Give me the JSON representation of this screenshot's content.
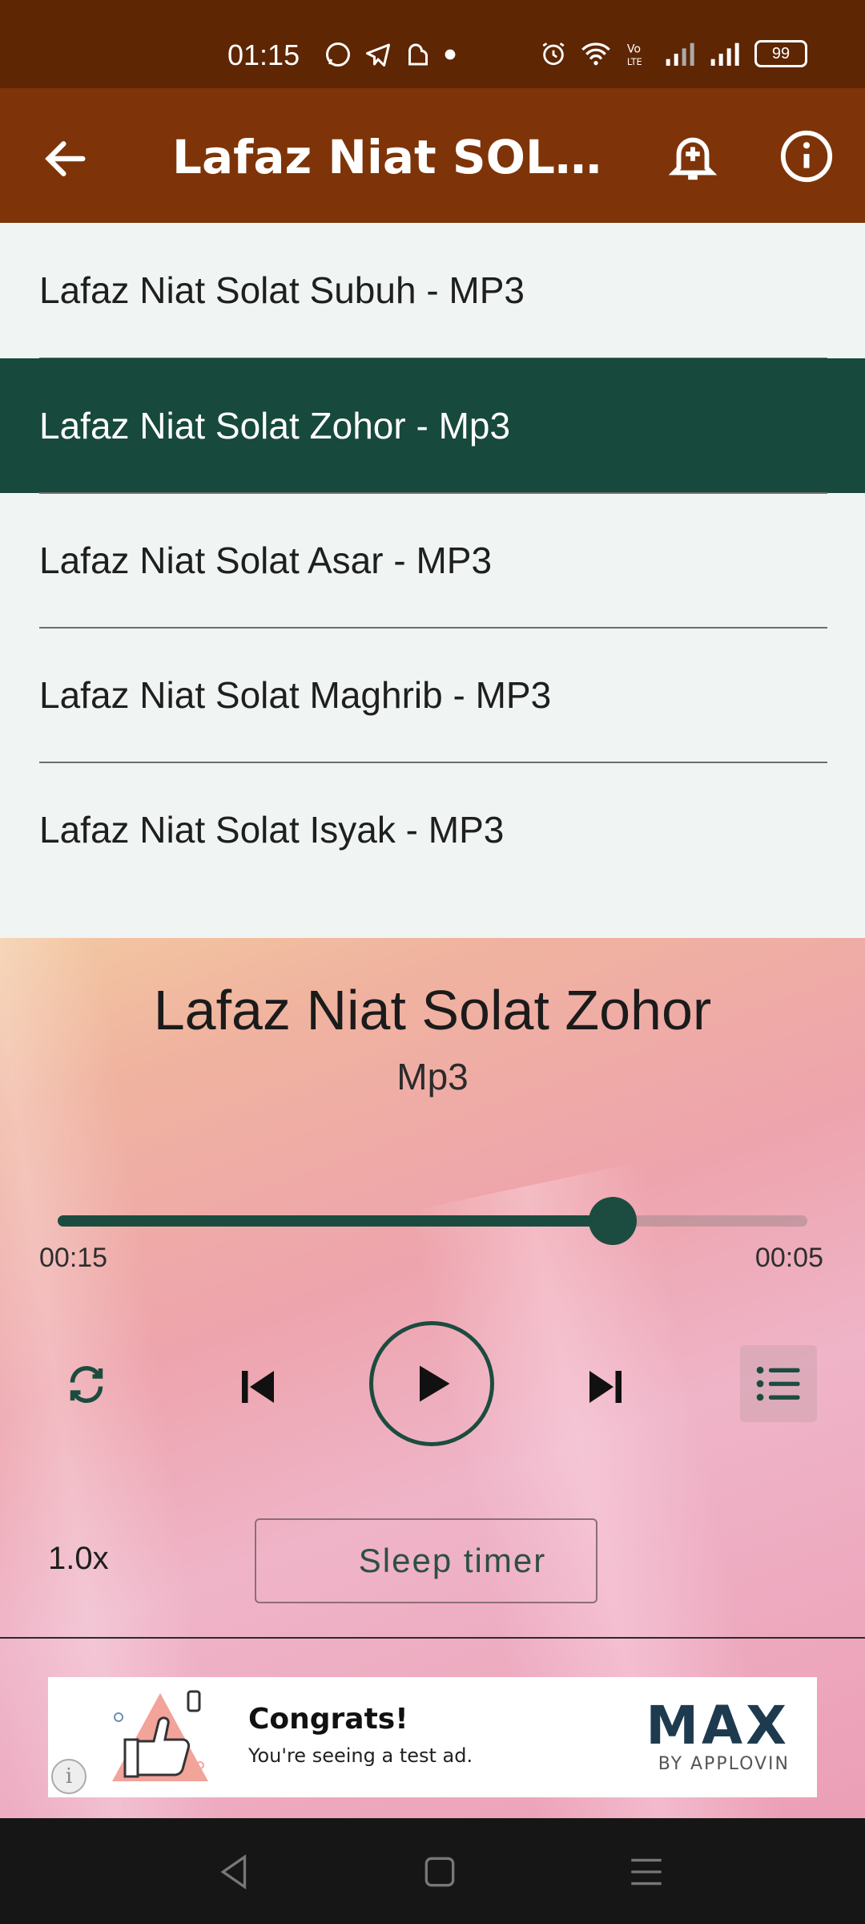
{
  "status_bar": {
    "time": "01:15",
    "battery": "99"
  },
  "app_bar": {
    "title": "Lafaz Niat SOLAT ..."
  },
  "tracks": [
    {
      "label": "Lafaz Niat Solat Subuh - MP3"
    },
    {
      "label": "Lafaz Niat Solat Zohor - Mp3"
    },
    {
      "label": "Lafaz Niat Solat Asar - MP3"
    },
    {
      "label": "Lafaz Niat Solat Maghrib - MP3"
    },
    {
      "label": "Lafaz Niat Solat Isyak - MP3"
    }
  ],
  "active_track_index": 1,
  "player": {
    "title": "Lafaz Niat Solat Zohor",
    "subtitle": "Mp3",
    "progress_fraction": 0.74,
    "time_elapsed": "00:15",
    "time_remaining": "00:05",
    "speed": "1.0x",
    "sleep_timer_label": "Sleep timer"
  },
  "ad": {
    "title": "Congrats!",
    "subtitle": "You're seeing a test ad.",
    "brand": "MAX",
    "brand_sub": "BY APPLOVIN"
  },
  "colors": {
    "accent": "#1b4c3f",
    "app_bar": "#7e3408",
    "status_bar": "#5e2603"
  }
}
